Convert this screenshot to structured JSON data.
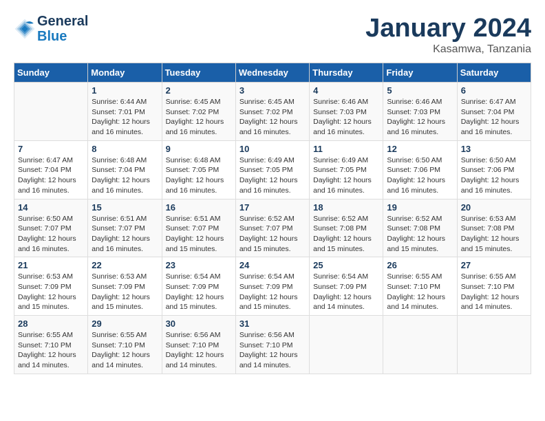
{
  "header": {
    "logo_line1": "General",
    "logo_line2": "Blue",
    "month": "January 2024",
    "location": "Kasamwa, Tanzania"
  },
  "days_of_week": [
    "Sunday",
    "Monday",
    "Tuesday",
    "Wednesday",
    "Thursday",
    "Friday",
    "Saturday"
  ],
  "weeks": [
    [
      {
        "day": "",
        "info": ""
      },
      {
        "day": "1",
        "info": "Sunrise: 6:44 AM\nSunset: 7:01 PM\nDaylight: 12 hours\nand 16 minutes."
      },
      {
        "day": "2",
        "info": "Sunrise: 6:45 AM\nSunset: 7:02 PM\nDaylight: 12 hours\nand 16 minutes."
      },
      {
        "day": "3",
        "info": "Sunrise: 6:45 AM\nSunset: 7:02 PM\nDaylight: 12 hours\nand 16 minutes."
      },
      {
        "day": "4",
        "info": "Sunrise: 6:46 AM\nSunset: 7:03 PM\nDaylight: 12 hours\nand 16 minutes."
      },
      {
        "day": "5",
        "info": "Sunrise: 6:46 AM\nSunset: 7:03 PM\nDaylight: 12 hours\nand 16 minutes."
      },
      {
        "day": "6",
        "info": "Sunrise: 6:47 AM\nSunset: 7:04 PM\nDaylight: 12 hours\nand 16 minutes."
      }
    ],
    [
      {
        "day": "7",
        "info": "Sunrise: 6:47 AM\nSunset: 7:04 PM\nDaylight: 12 hours\nand 16 minutes."
      },
      {
        "day": "8",
        "info": "Sunrise: 6:48 AM\nSunset: 7:04 PM\nDaylight: 12 hours\nand 16 minutes."
      },
      {
        "day": "9",
        "info": "Sunrise: 6:48 AM\nSunset: 7:05 PM\nDaylight: 12 hours\nand 16 minutes."
      },
      {
        "day": "10",
        "info": "Sunrise: 6:49 AM\nSunset: 7:05 PM\nDaylight: 12 hours\nand 16 minutes."
      },
      {
        "day": "11",
        "info": "Sunrise: 6:49 AM\nSunset: 7:05 PM\nDaylight: 12 hours\nand 16 minutes."
      },
      {
        "day": "12",
        "info": "Sunrise: 6:50 AM\nSunset: 7:06 PM\nDaylight: 12 hours\nand 16 minutes."
      },
      {
        "day": "13",
        "info": "Sunrise: 6:50 AM\nSunset: 7:06 PM\nDaylight: 12 hours\nand 16 minutes."
      }
    ],
    [
      {
        "day": "14",
        "info": "Sunrise: 6:50 AM\nSunset: 7:07 PM\nDaylight: 12 hours\nand 16 minutes."
      },
      {
        "day": "15",
        "info": "Sunrise: 6:51 AM\nSunset: 7:07 PM\nDaylight: 12 hours\nand 16 minutes."
      },
      {
        "day": "16",
        "info": "Sunrise: 6:51 AM\nSunset: 7:07 PM\nDaylight: 12 hours\nand 15 minutes."
      },
      {
        "day": "17",
        "info": "Sunrise: 6:52 AM\nSunset: 7:07 PM\nDaylight: 12 hours\nand 15 minutes."
      },
      {
        "day": "18",
        "info": "Sunrise: 6:52 AM\nSunset: 7:08 PM\nDaylight: 12 hours\nand 15 minutes."
      },
      {
        "day": "19",
        "info": "Sunrise: 6:52 AM\nSunset: 7:08 PM\nDaylight: 12 hours\nand 15 minutes."
      },
      {
        "day": "20",
        "info": "Sunrise: 6:53 AM\nSunset: 7:08 PM\nDaylight: 12 hours\nand 15 minutes."
      }
    ],
    [
      {
        "day": "21",
        "info": "Sunrise: 6:53 AM\nSunset: 7:09 PM\nDaylight: 12 hours\nand 15 minutes."
      },
      {
        "day": "22",
        "info": "Sunrise: 6:53 AM\nSunset: 7:09 PM\nDaylight: 12 hours\nand 15 minutes."
      },
      {
        "day": "23",
        "info": "Sunrise: 6:54 AM\nSunset: 7:09 PM\nDaylight: 12 hours\nand 15 minutes."
      },
      {
        "day": "24",
        "info": "Sunrise: 6:54 AM\nSunset: 7:09 PM\nDaylight: 12 hours\nand 15 minutes."
      },
      {
        "day": "25",
        "info": "Sunrise: 6:54 AM\nSunset: 7:09 PM\nDaylight: 12 hours\nand 14 minutes."
      },
      {
        "day": "26",
        "info": "Sunrise: 6:55 AM\nSunset: 7:10 PM\nDaylight: 12 hours\nand 14 minutes."
      },
      {
        "day": "27",
        "info": "Sunrise: 6:55 AM\nSunset: 7:10 PM\nDaylight: 12 hours\nand 14 minutes."
      }
    ],
    [
      {
        "day": "28",
        "info": "Sunrise: 6:55 AM\nSunset: 7:10 PM\nDaylight: 12 hours\nand 14 minutes."
      },
      {
        "day": "29",
        "info": "Sunrise: 6:55 AM\nSunset: 7:10 PM\nDaylight: 12 hours\nand 14 minutes."
      },
      {
        "day": "30",
        "info": "Sunrise: 6:56 AM\nSunset: 7:10 PM\nDaylight: 12 hours\nand 14 minutes."
      },
      {
        "day": "31",
        "info": "Sunrise: 6:56 AM\nSunset: 7:10 PM\nDaylight: 12 hours\nand 14 minutes."
      },
      {
        "day": "",
        "info": ""
      },
      {
        "day": "",
        "info": ""
      },
      {
        "day": "",
        "info": ""
      }
    ]
  ]
}
